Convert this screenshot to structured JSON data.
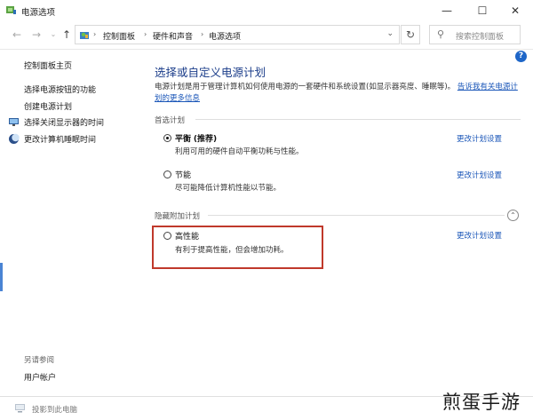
{
  "window": {
    "title": "电源选项",
    "min": "—",
    "max": "☐",
    "close": "✕"
  },
  "nav": {
    "back": "←",
    "forward": "→",
    "recent": "⌄",
    "up": "↑",
    "crumbs": [
      "控制面板",
      "硬件和声音",
      "电源选项"
    ],
    "crumb_sep": "›",
    "dropdown": "⌄",
    "refresh": "↻",
    "search_placeholder": "搜索控制面板",
    "search_icon": "⚲"
  },
  "help": "?",
  "sidebar": {
    "home": "控制面板主页",
    "links": [
      {
        "label": "选择电源按钮的功能"
      },
      {
        "label": "创建电源计划"
      },
      {
        "label": "选择关闭显示器的时间"
      },
      {
        "label": "更改计算机睡眠时间"
      }
    ],
    "see_also": "另请参阅",
    "user_accounts": "用户帐户"
  },
  "main": {
    "title": "选择或自定义电源计划",
    "desc_text": "电源计划是用于管理计算机如何使用电源的一套硬件和系统设置(如显示器亮度、睡眠等)。",
    "desc_link": "告诉我有关电源计划的更多信息",
    "section_preferred": "首选计划",
    "section_hidden": "隐藏附加计划",
    "collapse": "⌃",
    "change_link": "更改计划设置",
    "plans": [
      {
        "name": "平衡",
        "tag": "(推荐)",
        "desc": "利用可用的硬件自动平衡功耗与性能。",
        "selected": true
      },
      {
        "name": "节能",
        "tag": "",
        "desc": "尽可能降低计算机性能以节能。",
        "selected": false
      },
      {
        "name": "高性能",
        "tag": "",
        "desc": "有利于提高性能，但会增加功耗。",
        "selected": false
      }
    ]
  },
  "bottom": {
    "project": "投影到此电脑"
  },
  "watermark": "煎蛋手游",
  "colors": {
    "accent_link": "#1a56b8",
    "title_blue": "#1b3d8a",
    "highlight": "#c0392b"
  }
}
